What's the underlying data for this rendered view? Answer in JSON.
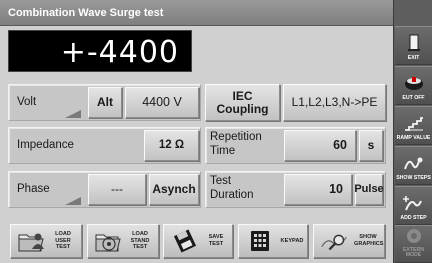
{
  "window": {
    "title": "Combination Wave Surge test"
  },
  "display": {
    "value": "+-4400"
  },
  "volt": {
    "label": "Volt",
    "alt_label": "Alt",
    "value": "4400 V",
    "coupling_label": "IEC\nCoupling",
    "coupling_value": "L1,L2,L3,N->PE"
  },
  "impedance": {
    "label": "Impedance",
    "value": "12 Ω",
    "repetition_label": "Repetition\nTime",
    "repetition_value": "60",
    "repetition_unit": "s"
  },
  "phase": {
    "label": "Phase",
    "value": "---",
    "mode": "Asynch",
    "duration_label": "Test\nDuration",
    "duration_value": "10",
    "duration_unit": "Pulse"
  },
  "toolbar": {
    "load_user_test": "LOAD\nUSER\nTEST",
    "load_stand_test": "LOAD\nSTAND\nTEST",
    "save_test": "SAVE\nTEST",
    "keypad": "KEYPAD",
    "show_graphics": "SHOW\nGRAPHICS"
  },
  "side": {
    "exit": "EXIT",
    "eut_off": "EUT OFF",
    "ramp_value": "RAMP VALUE",
    "show_steps": "SHOW STEPS",
    "add_step": "ADD STEP",
    "extern_mode": "EXTERN\nMODE"
  }
}
